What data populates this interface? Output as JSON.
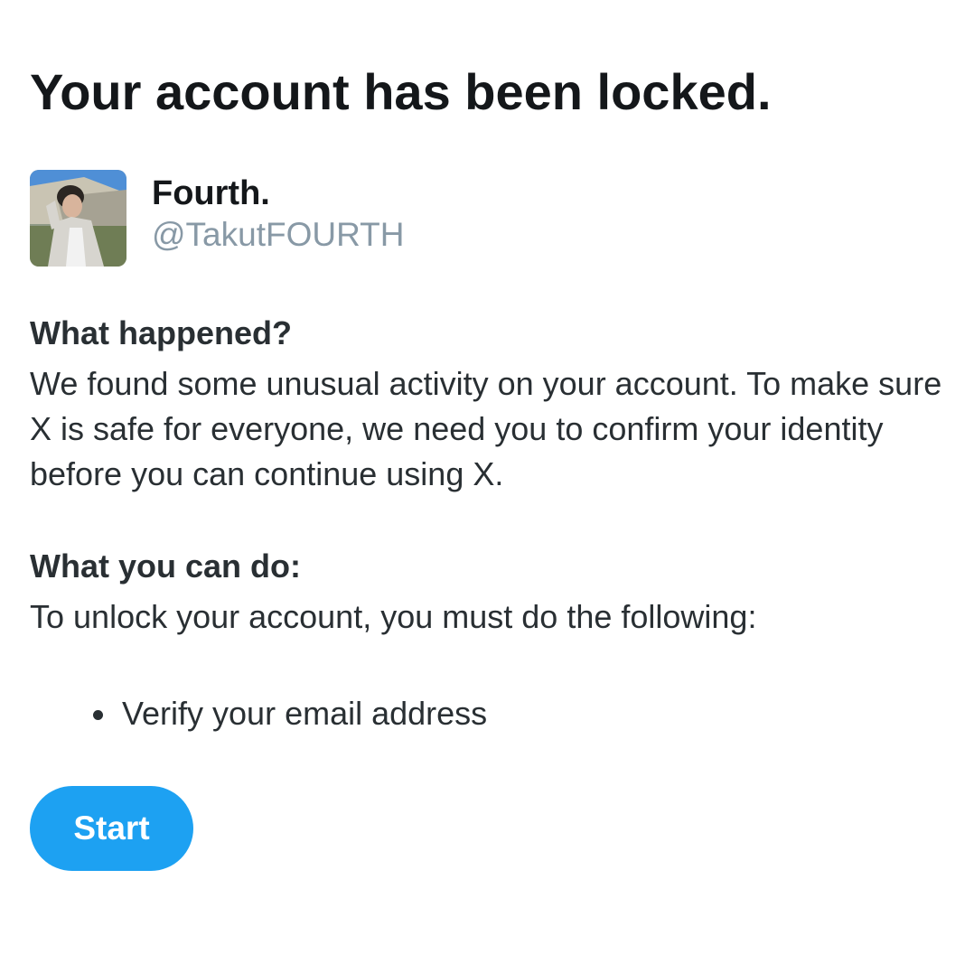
{
  "title": "Your account has been locked.",
  "profile": {
    "display_name": "Fourth.",
    "handle": "@TakutFOURTH"
  },
  "what_happened": {
    "heading": "What happened?",
    "body": "We found some unusual activity on your account. To make sure X is safe for everyone, we need you to confirm your identity before you can continue using X."
  },
  "what_you_can_do": {
    "heading": "What you can do:",
    "body": "To unlock your account, you must do the following:",
    "steps": [
      "Verify your email address"
    ]
  },
  "start_button": {
    "label": "Start"
  },
  "colors": {
    "accent": "#1da1f2",
    "heading_text": "#14171a",
    "body_text": "#292f33",
    "handle_text": "#8899a6",
    "background": "#ffffff"
  }
}
